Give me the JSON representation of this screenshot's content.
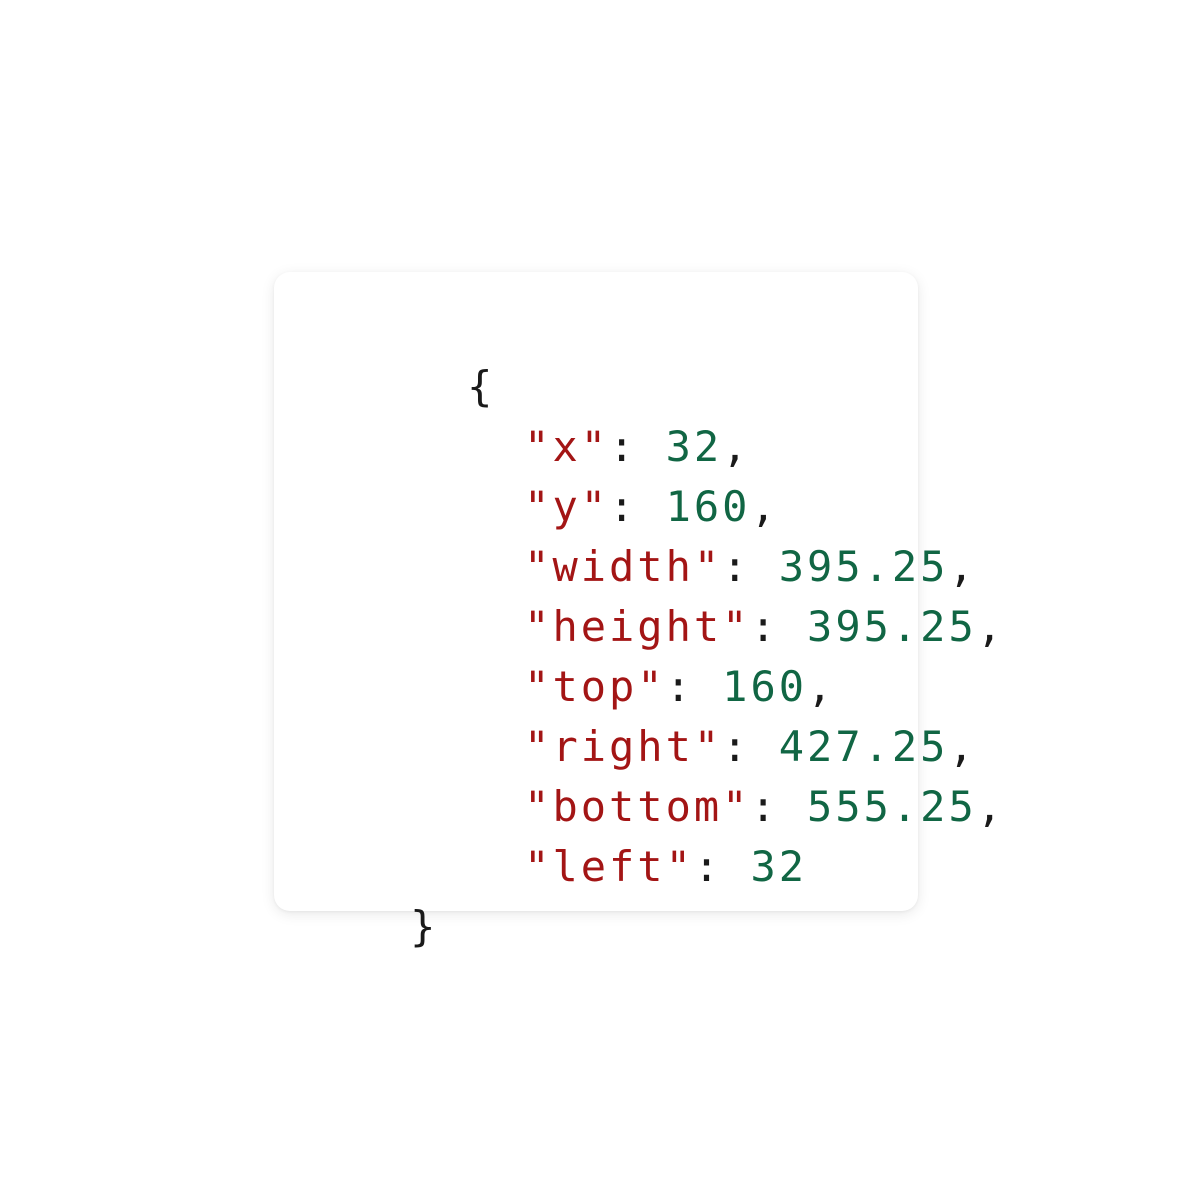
{
  "snippet": {
    "open_brace": "{",
    "close_brace": "}",
    "colon": ": ",
    "comma": ",",
    "entries": [
      {
        "key": "\"x\"",
        "value": "32"
      },
      {
        "key": "\"y\"",
        "value": "160"
      },
      {
        "key": "\"width\"",
        "value": "395.25"
      },
      {
        "key": "\"height\"",
        "value": "395.25"
      },
      {
        "key": "\"top\"",
        "value": "160"
      },
      {
        "key": "\"right\"",
        "value": "427.25"
      },
      {
        "key": "\"bottom\"",
        "value": "555.25"
      },
      {
        "key": "\"left\"",
        "value": "32"
      }
    ]
  },
  "colors": {
    "key": "#a31515",
    "number": "#116644",
    "punctuation": "#1a1a1a",
    "card_background": "#ffffff"
  }
}
